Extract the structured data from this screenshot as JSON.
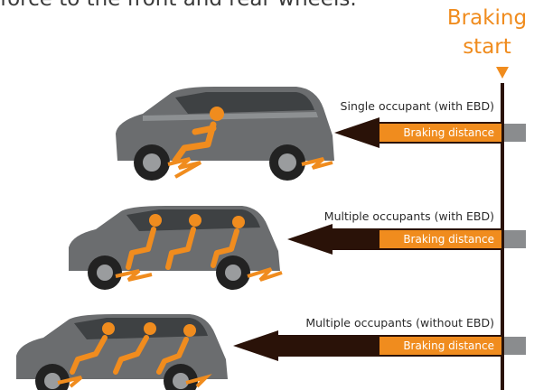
{
  "intro_text": "force to the front and rear wheels.",
  "start": {
    "label_line1": "Braking",
    "label_line2": "start"
  },
  "rows": [
    {
      "label": "Single occupant (with EBD)",
      "bar_label": "Braking distance"
    },
    {
      "label": "Multiple occupants (with EBD)",
      "bar_label": "Braking distance"
    },
    {
      "label": "Multiple occupants (without EBD)",
      "bar_label": "Braking distance"
    }
  ],
  "colors": {
    "accent": "#f08c1e",
    "arrow": "#2a1208",
    "car_body": "#6b6d6f",
    "end_marker": "#8a8c8e"
  }
}
